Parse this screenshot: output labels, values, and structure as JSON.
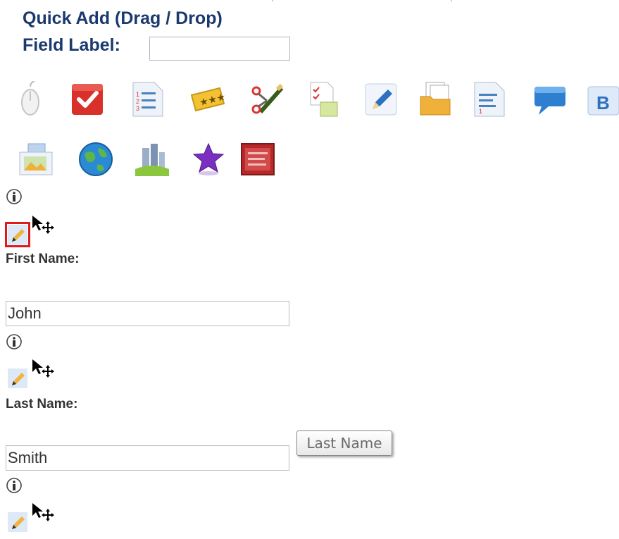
{
  "header": {
    "title": "Quick Add (Drag / Drop)",
    "field_label_text": "Field Label:",
    "field_label_value": ""
  },
  "toolbar": {
    "row1": [
      "mouse-icon",
      "checkbox-icon",
      "numbered-list-icon",
      "rating-stars-icon",
      "scissors-pencil-icon",
      "checklist-document-icon",
      "pencil-edit-icon",
      "document-folder-icon",
      "text-document-icon",
      "speech-bubble-icon",
      "bold-text-icon"
    ],
    "row2": [
      "image-frame-icon",
      "globe-icon",
      "city-buildings-icon",
      "purple-star-icon",
      "red-panel-icon"
    ]
  },
  "fields": [
    {
      "label": "First Name:",
      "value": "John"
    },
    {
      "label": "Last Name:",
      "value": "Smith"
    }
  ],
  "tooltip": {
    "text": "Last Name"
  },
  "colors": {
    "heading": "#1a3a6e",
    "selection_outline": "#e01b1b"
  }
}
